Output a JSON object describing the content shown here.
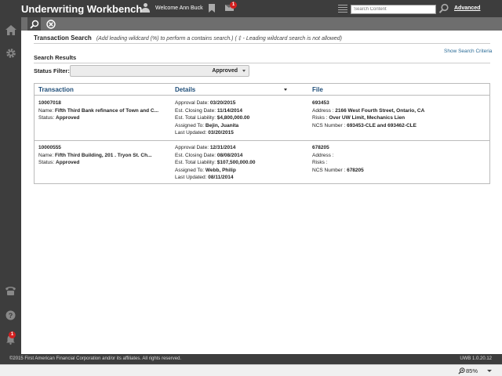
{
  "header": {
    "app_title": "Underwriting Workbench",
    "welcome": "Welcome Ann Buck",
    "mail_badge": "1",
    "search_placeholder": "Search Content",
    "advanced_link": "Advanced"
  },
  "rail": {
    "alert_badge": "1"
  },
  "page": {
    "title": "Transaction Search",
    "hint": "(Add leading wildcard (%) to perform a contains search.) ( ‡ - Leading wildcard search is not allowed)",
    "show_criteria": "Show Search Criteria",
    "results_title": "Search Results",
    "status_filter_label": "Status Filter:",
    "status_filter_value": "Approved"
  },
  "table": {
    "headers": {
      "transaction": "Transaction",
      "details": "Details",
      "file": "File"
    },
    "rows": [
      {
        "id": "10007018",
        "name_label": "Name: ",
        "name": "Fifth Third Bank refinance of Town and C...",
        "status_label": "Status: ",
        "status": "Approved",
        "approval_label": "Approval Date: ",
        "approval": "03/20/2015",
        "closing_label": "Est. Closing Date: ",
        "closing": "11/14/2014",
        "liability_label": "Est. Total Liability: ",
        "liability": "$4,800,000.00",
        "assigned_label": "Assigned To: ",
        "assigned": "Bejin, Juanita",
        "updated_label": "Last Updated: ",
        "updated": "03/20/2015",
        "file_no": "693453",
        "address_label": "Address : ",
        "address": "2166 West Fourth Street, Ontario, CA",
        "risks_label": "Risks : ",
        "risks": "Over UW Limit, Mechanics Lien",
        "ncs_label": "NCS Number : ",
        "ncs": "693453-CLE and 693462-CLE"
      },
      {
        "id": "10000555",
        "name_label": "Name: ",
        "name": "Fifth Third Building, 201 . Tryon St. Ch...",
        "status_label": "Status: ",
        "status": "Approved",
        "approval_label": "Approval Date: ",
        "approval": "12/31/2014",
        "closing_label": "Est. Closing Date: ",
        "closing": "08/08/2014",
        "liability_label": "Est. Total Liability: ",
        "liability": "$107,500,000.00",
        "assigned_label": "Assigned To: ",
        "assigned": "Webb, Philip",
        "updated_label": "Last Updated: ",
        "updated": "08/11/2014",
        "file_no": "678205",
        "address_label": "Address : ",
        "address": "",
        "risks_label": "Risks : ",
        "risks": "",
        "ncs_label": "NCS Number : ",
        "ncs": "678205"
      }
    ]
  },
  "footer": {
    "copyright": "©2015 First American Financial Corporation and/or its affiliates. All rights reserved.",
    "version": "UWB 1.0.20.12"
  },
  "statusbar": {
    "zoom": "85%"
  },
  "icons": [
    "user-icon",
    "bookmark-icon",
    "mail-icon",
    "list-icon",
    "search-icon",
    "home-icon",
    "gear-icon",
    "phone-icon",
    "help-icon",
    "bell-icon",
    "close-circle-icon"
  ]
}
